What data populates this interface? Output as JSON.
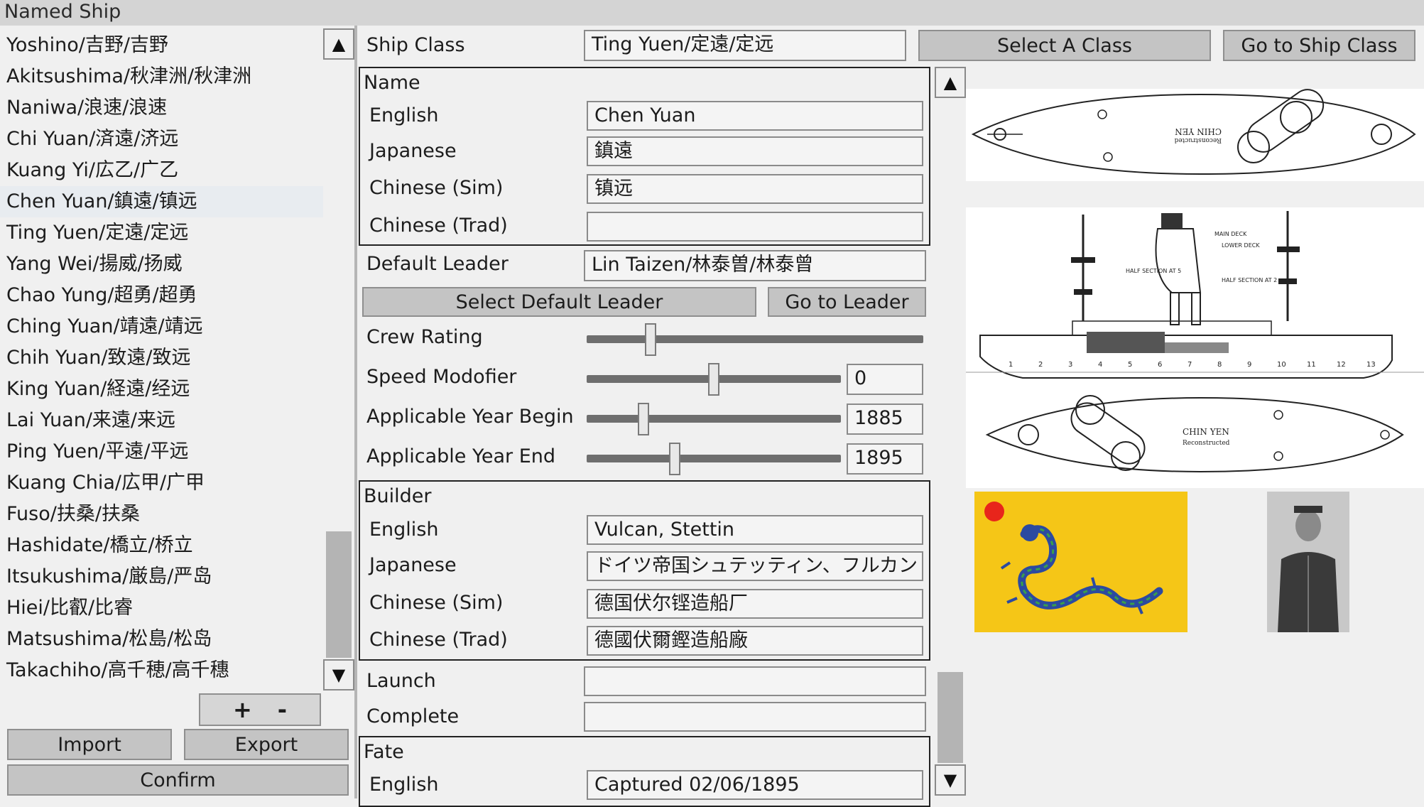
{
  "window": {
    "title": "Named Ship"
  },
  "ship_list": {
    "items": [
      "Yoshino/吉野/吉野",
      "Akitsushima/秋津洲/秋津洲",
      "Naniwa/浪速/浪速",
      "Chi Yuan/済遠/济远",
      "Kuang Yi/広乙/广乙",
      "Chen Yuan/鎮遠/镇远",
      "Ting Yuen/定遠/定远",
      "Yang Wei/揚威/扬威",
      "Chao Yung/超勇/超勇",
      "Ching Yuan/靖遠/靖远",
      "Chih Yuan/致遠/致远",
      "King Yuan/経遠/经远",
      "Lai Yuan/来遠/来远",
      "Ping Yuen/平遠/平远",
      "Kuang Chia/広甲/广甲",
      "Fuso/扶桑/扶桑",
      "Hashidate/橋立/桥立",
      "Itsukushima/厳島/严岛",
      "Hiei/比叡/比睿",
      "Matsushima/松島/松岛",
      "Takachiho/高千穂/高千穗"
    ],
    "selected_index": 5,
    "scroll_up": "▲",
    "scroll_down": "▼"
  },
  "list_actions": {
    "add": "+",
    "remove": "-",
    "import": "Import",
    "export": "Export",
    "confirm": "Confirm"
  },
  "header": {
    "ship_class_label": "Ship Class",
    "ship_class_value": "Ting Yuen/定遠/定远",
    "select_class_button": "Select A Class",
    "go_to_class_button": "Go to Ship Class"
  },
  "name_group": {
    "title": "Name",
    "english_label": "English",
    "english_value": "Chen Yuan",
    "japanese_label": "Japanese",
    "japanese_value": "鎮遠",
    "chinese_sim_label": "Chinese (Sim)",
    "chinese_sim_value": "镇远",
    "chinese_trad_label": "Chinese (Trad)",
    "chinese_trad_value": ""
  },
  "leader": {
    "label": "Default Leader",
    "value": "Lin Taizen/林泰曽/林泰曾",
    "select_button": "Select Default Leader",
    "go_button": "Go to Leader"
  },
  "sliders": {
    "crew_rating_label": "Crew Rating",
    "crew_rating_fraction": 0.18,
    "speed_label": "Speed Modofier",
    "speed_value": "0",
    "speed_fraction": 0.5,
    "year_begin_label": "Applicable Year Begin",
    "year_begin_value": "1885",
    "year_begin_fraction": 0.21,
    "year_end_label": "Applicable Year End",
    "year_end_value": "1895",
    "year_end_fraction": 0.34
  },
  "builder_group": {
    "title": "Builder",
    "english_label": "English",
    "english_value": "Vulcan, Stettin",
    "japanese_label": "Japanese",
    "japanese_value": "ドイツ帝国シュテッティン、フルカン",
    "chinese_sim_label": "Chinese (Sim)",
    "chinese_sim_value": "德国伏尔铿造船厂",
    "chinese_trad_label": "Chinese (Trad)",
    "chinese_trad_value": "德國伏爾鏗造船廠"
  },
  "dates": {
    "launch_label": "Launch",
    "launch_value": "",
    "complete_label": "Complete",
    "complete_value": ""
  },
  "fate_group": {
    "title": "Fate",
    "english_label": "English",
    "english_value": "Captured 02/06/1895"
  },
  "form_scroll": {
    "up": "▲",
    "down": "▼"
  },
  "images": {
    "plan_top_label": "CHIN YEN",
    "plan_top_sub": "Reconstructed",
    "side_note_1": "HALF SECTION AT 5",
    "side_note_2": "HALF SECTION AT 2",
    "side_note_3": "MAIN DECK",
    "side_note_4": "LOWER DECK",
    "plan_bottom_label": "CHIN YEN",
    "plan_bottom_sub": "Reconstructed",
    "frame_numbers": [
      "1",
      "2",
      "3",
      "4",
      "5",
      "6",
      "7",
      "8",
      "9",
      "10",
      "11",
      "12",
      "13"
    ],
    "flag_colors": {
      "field": "#f5c617",
      "sun": "#e8251b",
      "dragon": "#2c4aa0"
    }
  }
}
